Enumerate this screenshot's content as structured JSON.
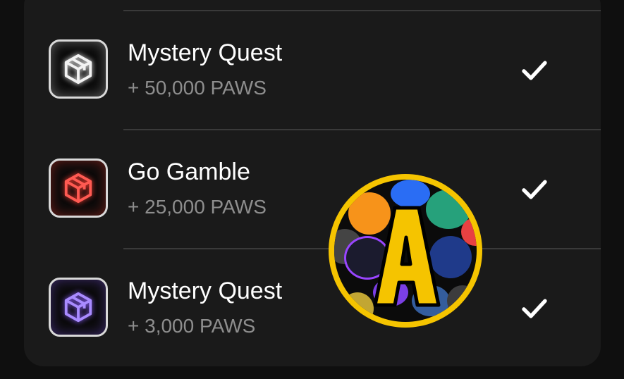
{
  "quests": [
    {
      "title": "Mystery Quest",
      "reward": "+ 50,000 PAWS",
      "icon": "box-icon",
      "icon_color": "#f2f2f2",
      "glow": "#ffffff",
      "completed": true
    },
    {
      "title": "Go Gamble",
      "reward": "+ 25,000 PAWS",
      "icon": "box-icon",
      "icon_color": "#ff5a52",
      "glow": "#ff3b30",
      "completed": true
    },
    {
      "title": "Mystery Quest",
      "reward": "+ 3,000 PAWS",
      "icon": "box-icon",
      "icon_color": "#a98bff",
      "glow": "#8a5cff",
      "completed": true
    }
  ],
  "overlay_badge": {
    "letter": "A",
    "ring_color": "#f5c400"
  },
  "colors": {
    "panel": "#1a1a1a",
    "background": "#0f0f0f",
    "title": "#ffffff",
    "reward": "#8e8e8e"
  }
}
